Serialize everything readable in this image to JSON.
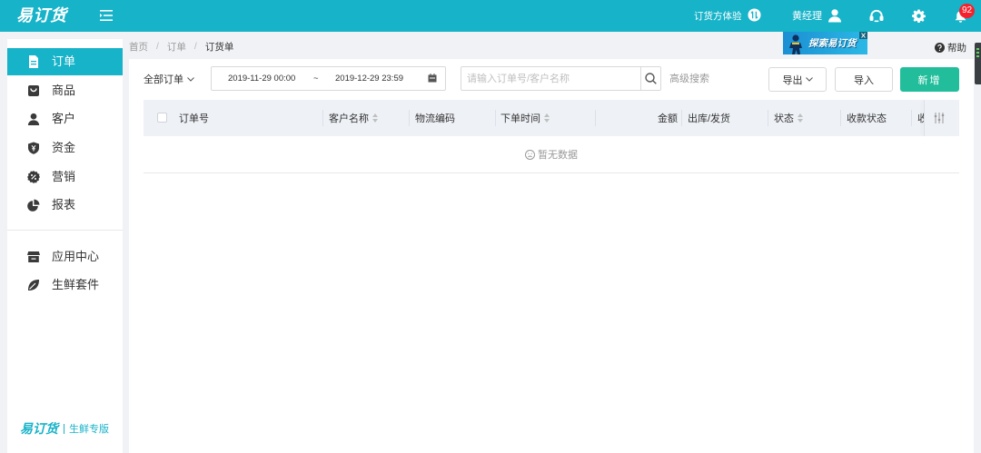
{
  "header": {
    "logo": "易订货",
    "menu_icon": "menu-fold-icon",
    "demo_label": "订货方体验",
    "demo_icon": "switch-icon",
    "user_name": "黄经理",
    "user_icon": "user-icon",
    "action_icons": [
      "support-icon",
      "gear-icon",
      "bell-icon"
    ],
    "notification_count": "92"
  },
  "sidebar": {
    "items": [
      {
        "label": "订单",
        "icon": "order-icon",
        "active": true
      },
      {
        "label": "商品",
        "icon": "goods-icon",
        "active": false
      },
      {
        "label": "客户",
        "icon": "customer-icon",
        "active": false
      },
      {
        "label": "资金",
        "icon": "funds-icon",
        "active": false
      },
      {
        "label": "营销",
        "icon": "marketing-icon",
        "active": false
      },
      {
        "label": "报表",
        "icon": "report-icon",
        "active": false
      }
    ],
    "extra_items": [
      {
        "label": "应用中心",
        "icon": "store-icon"
      },
      {
        "label": "生鲜套件",
        "icon": "leaf-icon"
      }
    ],
    "footer": {
      "logo": "易订货",
      "edition": "生鲜专版"
    }
  },
  "breadcrumb": {
    "items": [
      "首页",
      "订单",
      "订货单"
    ],
    "separator": "/"
  },
  "promo_banner": {
    "text": "探索易订货",
    "close_icon": "close-icon"
  },
  "help": {
    "label": "帮助",
    "icon": "question-circle-icon"
  },
  "toolbar": {
    "filter_label": "全部订单",
    "date_range": {
      "start": "2019-11-29 00:00",
      "separator": "~",
      "end": "2019-12-29 23:59",
      "icon": "calendar-icon"
    },
    "search": {
      "placeholder": "请输入订单号/客户名称",
      "icon": "search-icon"
    },
    "advanced_search_label": "高级搜索",
    "export_label": "导出",
    "import_label": "导入",
    "add_label": "新增"
  },
  "table": {
    "columns": [
      {
        "label": "订单号",
        "sortable": false
      },
      {
        "label": "客户名称",
        "sortable": true
      },
      {
        "label": "物流编码",
        "sortable": false
      },
      {
        "label": "下单时间",
        "sortable": true
      },
      {
        "label": "金额",
        "sortable": false
      },
      {
        "label": "出库/发货",
        "sortable": false
      },
      {
        "label": "状态",
        "sortable": true
      },
      {
        "label": "收款状态",
        "sortable": false
      },
      {
        "label": "收",
        "sortable": false
      }
    ],
    "settings_icon": "column-settings-icon",
    "rows": [],
    "empty_text": "暂无数据",
    "empty_icon": "frown-icon"
  },
  "colors": {
    "primary": "#17b3c9",
    "add_button": "#22be9c",
    "badge": "#f5222d",
    "page_background": "#f0f2f5"
  }
}
